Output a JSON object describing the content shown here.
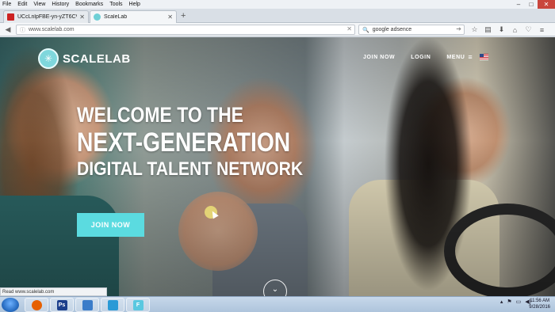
{
  "menubar": {
    "items": [
      "File",
      "Edit",
      "View",
      "History",
      "Bookmarks",
      "Tools",
      "Help"
    ]
  },
  "window_controls": {
    "minimize": "–",
    "maximize": "□",
    "close": "✕"
  },
  "tabs": [
    {
      "label": "UCcLnlpFBE-yn-yZT6CV03...",
      "close": "✕"
    },
    {
      "label": "ScaleLab",
      "close": "✕"
    }
  ],
  "new_tab": "+",
  "navbar": {
    "url": "www.scalelab.com",
    "search_value": "google adsence"
  },
  "site": {
    "logo_text": "SCALELAB",
    "nav": {
      "join": "JOIN NOW",
      "login": "LOGIN",
      "menu": "MENU"
    },
    "headline": {
      "line1": "WELCOME TO THE",
      "line2": "NEXT-GENERATION",
      "line3": "DIGITAL TALENT NETWORK"
    },
    "cta": "JOIN NOW"
  },
  "statusbar": {
    "text": "Read www.scalelab.com"
  },
  "taskbar": {
    "apps": [
      {
        "name": "firefox-icon",
        "color": "#e66000"
      },
      {
        "name": "photoshop-icon",
        "color": "#1c3f8c",
        "label": "Ps"
      },
      {
        "name": "explorer-icon",
        "color": "#3a7cc9"
      },
      {
        "name": "app-icon",
        "color": "#2a9ad6"
      },
      {
        "name": "f-app-icon",
        "color": "#5ac8e0",
        "label": "F"
      }
    ],
    "clock_time": "11:56 AM",
    "clock_date": "9/28/2016"
  },
  "colors": {
    "accent": "#5bdbe0",
    "logo": "#7fd7dc",
    "close": "#c9463d"
  }
}
